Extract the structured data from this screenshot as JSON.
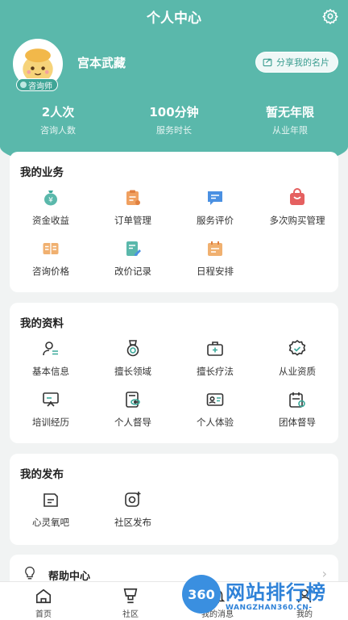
{
  "header": {
    "title": "个人中心",
    "username": "宫本武藏",
    "role_badge": "咨询师",
    "share_label": "分享我的名片"
  },
  "stats": [
    {
      "value": "2人次",
      "label": "咨询人数"
    },
    {
      "value": "100分钟",
      "label": "服务时长"
    },
    {
      "value": "暂无年限",
      "label": "从业年限"
    }
  ],
  "sections": {
    "business": {
      "title": "我的业务",
      "items": [
        {
          "label": "资金收益",
          "icon": "money-bag-icon"
        },
        {
          "label": "订单管理",
          "icon": "clipboard-icon"
        },
        {
          "label": "服务评价",
          "icon": "comment-icon"
        },
        {
          "label": "多次购买管理",
          "icon": "shopping-bag-icon"
        },
        {
          "label": "咨询价格",
          "icon": "price-tag-icon"
        },
        {
          "label": "改价记录",
          "icon": "edit-document-icon"
        },
        {
          "label": "日程安排",
          "icon": "calendar-icon"
        }
      ]
    },
    "profile": {
      "title": "我的资料",
      "items": [
        {
          "label": "基本信息",
          "icon": "user-info-icon"
        },
        {
          "label": "擅长领域",
          "icon": "medal-icon"
        },
        {
          "label": "擅长疗法",
          "icon": "medical-kit-icon"
        },
        {
          "label": "从业资质",
          "icon": "certificate-badge-icon"
        },
        {
          "label": "培训经历",
          "icon": "presentation-board-icon"
        },
        {
          "label": "个人督导",
          "icon": "eye-document-icon"
        },
        {
          "label": "个人体验",
          "icon": "id-card-icon"
        },
        {
          "label": "团体督导",
          "icon": "group-calendar-icon"
        }
      ]
    },
    "publish": {
      "title": "我的发布",
      "items": [
        {
          "label": "心灵氧吧",
          "icon": "chat-box-icon"
        },
        {
          "label": "社区发布",
          "icon": "camera-plus-icon"
        }
      ]
    }
  },
  "help": {
    "label": "帮助中心"
  },
  "tabbar": [
    {
      "label": "首页",
      "icon": "home-icon"
    },
    {
      "label": "社区",
      "icon": "community-icon"
    },
    {
      "label": "我的消息",
      "icon": "bell-icon"
    },
    {
      "label": "我的",
      "icon": "user-icon"
    }
  ],
  "watermark": {
    "badge": "360",
    "text": "网站排行榜",
    "sub": "WANGZHAN360.CN-"
  },
  "colors": {
    "primary": "#5ab8ab",
    "orange": "#f0a060",
    "blue": "#4a90e2",
    "red": "#e56060",
    "teal": "#3aa99a"
  }
}
